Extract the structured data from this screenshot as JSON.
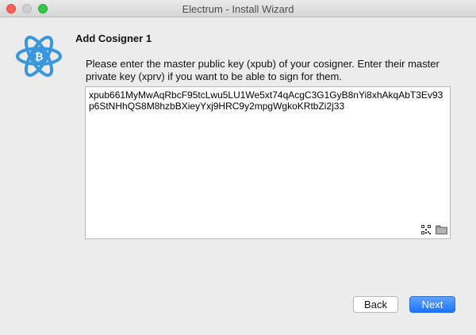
{
  "window": {
    "title": "Electrum  -  Install Wizard"
  },
  "wizard": {
    "heading": "Add Cosigner 1",
    "instruction": "Please enter the master public key (xpub) of your cosigner. Enter their master private key (xprv) if you want to be able to sign for them.",
    "key_value": "xpub661MyMwAqRbcF95tcLwu5LU1We5xt74qAcgC3G1GyB8nYi8xhAkqAbT3Ev93p6StNHhQS8M8hzbBXieyYxj9HRC9y2mpgWgkoKRtbZi2j33"
  },
  "buttons": {
    "back": "Back",
    "next": "Next"
  },
  "colors": {
    "accent": "#1b73f7",
    "logo": "#3a97dc"
  },
  "icons": [
    "electrum-logo-icon",
    "qr-code-icon",
    "folder-icon"
  ]
}
